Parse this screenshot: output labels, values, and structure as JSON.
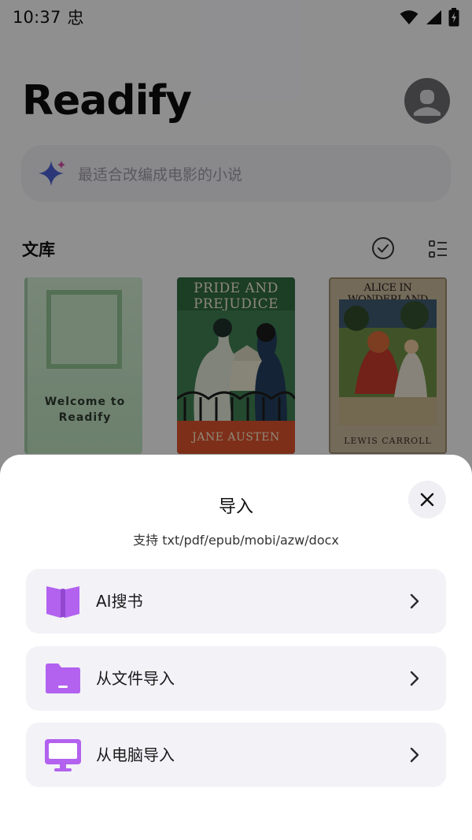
{
  "status_bar": {
    "time": "10:37",
    "debug_glyph": "忠"
  },
  "header": {
    "app_title": "Readify"
  },
  "search": {
    "placeholder": "最适合改编成电影的小说"
  },
  "library": {
    "title": "文库",
    "books": [
      {
        "cover_text": "Welcome to\nReadify"
      },
      {
        "title": "PRIDE AND\nPREJUDICE",
        "author": "JANE AUSTEN"
      },
      {
        "title": "ALICE IN WONDERLAND",
        "author": "LEWIS CARROLL"
      }
    ]
  },
  "sheet": {
    "title": "导入",
    "subtitle": "支持 txt/pdf/epub/mobi/azw/docx",
    "options": [
      {
        "label": "AI搜书",
        "icon": "book-open-icon"
      },
      {
        "label": "从文件导入",
        "icon": "folder-icon"
      },
      {
        "label": "从电脑导入",
        "icon": "monitor-icon"
      }
    ]
  },
  "colors": {
    "accent": "#b262ef",
    "sheet_bg": "#ffffff",
    "option_bg": "#f3f2f7"
  }
}
